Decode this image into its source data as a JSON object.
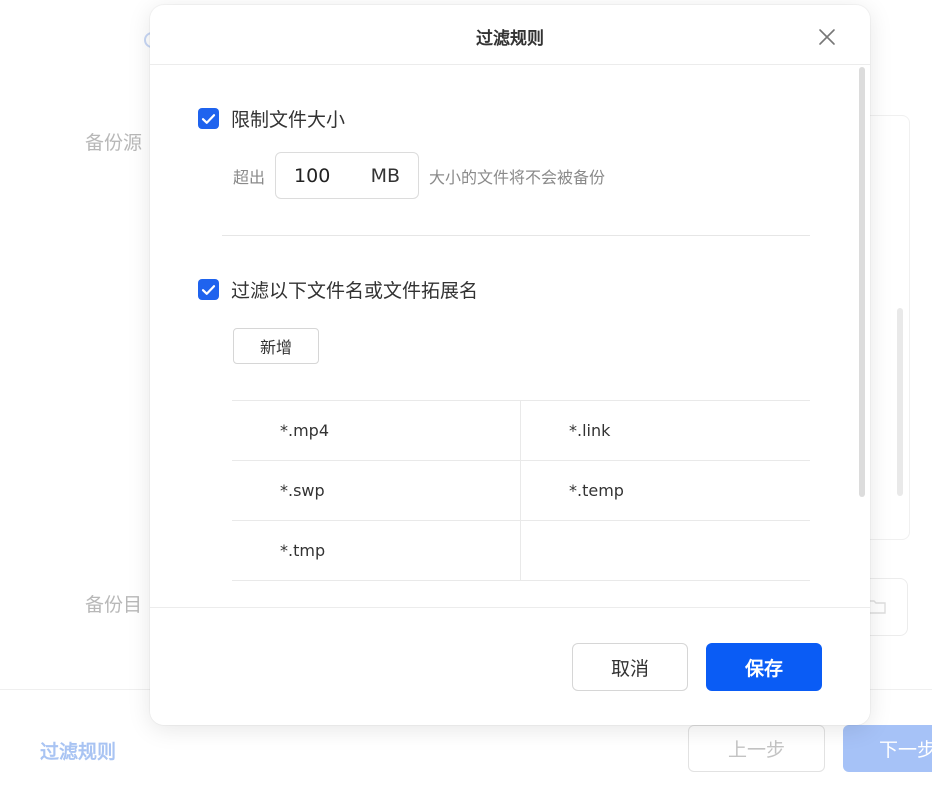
{
  "background": {
    "source_label": "备份源",
    "target_label": "备份目",
    "filter_link": "过滤规则",
    "prev_button": "上一步",
    "next_button": "下一步"
  },
  "modal": {
    "title": "过滤规则",
    "size_limit": {
      "checked": true,
      "label": "限制文件大小",
      "prefix": "超出",
      "value": "100",
      "unit": "MB",
      "suffix": "大小的文件将不会被备份"
    },
    "name_filter": {
      "checked": true,
      "label": "过滤以下文件名或文件拓展名",
      "add_button": "新增",
      "extensions": [
        "*.mp4",
        "*.link",
        "*.swp",
        "*.temp",
        "*.tmp",
        ""
      ]
    },
    "footer": {
      "cancel": "取消",
      "save": "保存"
    }
  },
  "colors": {
    "primary": "#0a5cf5",
    "checkbox": "#1f63ee",
    "faded_primary": "#a6c2f7"
  },
  "icons": [
    "close-icon",
    "checkmark-icon",
    "folder-icon"
  ]
}
